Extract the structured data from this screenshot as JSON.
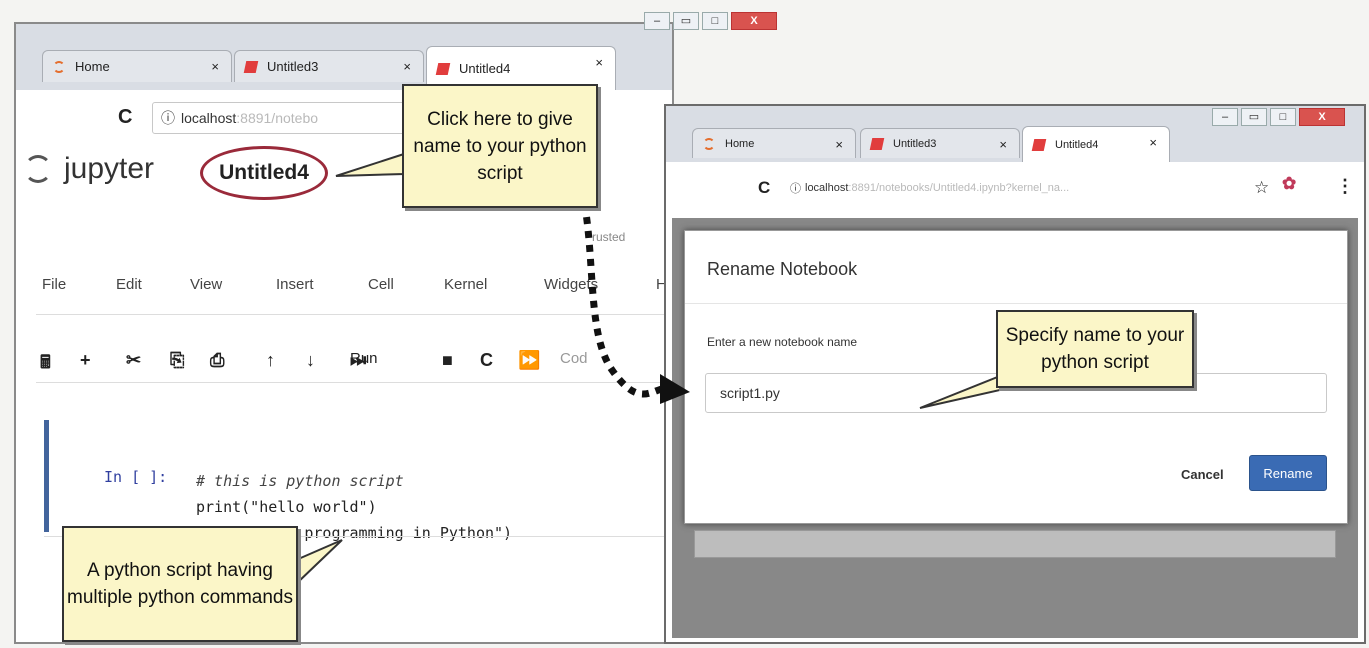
{
  "left_window": {
    "tabs": [
      {
        "label": "Home",
        "close": "×",
        "icon": "jupyter-icon"
      },
      {
        "label": "Untitled3",
        "close": "×",
        "icon": "notebook-icon"
      },
      {
        "label": "Untitled4",
        "close": "×",
        "icon": "notebook-icon"
      }
    ],
    "window_controls": {
      "minimize": "–",
      "restore": "▭",
      "maximize": "□",
      "close": "X"
    },
    "reload_icon": "C",
    "url": {
      "host": "localhost",
      "rest": ":8891/notebo"
    },
    "logo_text": "jupyter",
    "notebook_name": "Untitled4",
    "trusted": "rusted",
    "menu": [
      "File",
      "Edit",
      "View",
      "Insert",
      "Cell",
      "Kernel",
      "Widgets",
      "H"
    ],
    "toolbar": {
      "save": "🖩",
      "add": "+",
      "cut": "✂",
      "copy": "⎘",
      "paste": "⎙",
      "up": "↑",
      "down": "↓",
      "run_icon": "⏭",
      "run": "Run",
      "stop": "■",
      "restart": "C",
      "run_all": "⏩",
      "cell_type": "Cod"
    },
    "cell": {
      "prompt": "In [ ]:",
      "lines": [
        "# this is python script",
        "print(\"hello world\")",
        "print(\"I am programming in Python\")"
      ]
    }
  },
  "right_window": {
    "tabs": [
      {
        "label": "Home",
        "close": "×"
      },
      {
        "label": "Untitled3",
        "close": "×"
      },
      {
        "label": "Untitled4",
        "close": "×"
      }
    ],
    "window_controls": {
      "minimize": "–",
      "restore": "▭",
      "maximize": "□",
      "close": "X"
    },
    "reload_icon": "C",
    "url": {
      "host": "localhost",
      "rest": ":8891/notebooks/Untitled4.ipynb?kernel_na..."
    },
    "star_icon": "☆",
    "menu_icon": "⋮",
    "dialog": {
      "title": "Rename Notebook",
      "label": "Enter a new notebook name",
      "input_value": "script1.py",
      "cancel": "Cancel",
      "rename": "Rename"
    }
  },
  "callouts": {
    "name_hint": "Click here to give name to your python script",
    "script_hint": "A python script having multiple python commands",
    "specify_hint": "Specify name to your python script"
  },
  "colors": {
    "callout_bg": "#fbf6c8",
    "ellipse": "#9a2a3a",
    "rename_button": "#3a6bb4",
    "cell_border": "#42649c"
  }
}
